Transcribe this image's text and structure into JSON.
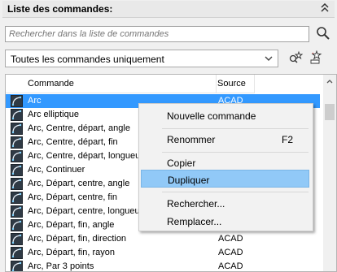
{
  "header": {
    "title": "Liste des commandes:"
  },
  "search": {
    "placeholder": "Rechercher dans la liste de commandes",
    "value": ""
  },
  "filter": {
    "selected": "Toutes les commandes uniquement"
  },
  "columns": {
    "command": "Commande",
    "source": "Source"
  },
  "rows": [
    {
      "name": "Arc",
      "source": "ACAD",
      "selected": true
    },
    {
      "name": "Arc elliptique",
      "source": ""
    },
    {
      "name": "Arc, Centre, départ, angle",
      "source": ""
    },
    {
      "name": "Arc, Centre, départ, fin",
      "source": ""
    },
    {
      "name": "Arc, Centre, départ, longueur",
      "source": ""
    },
    {
      "name": "Arc, Continuer",
      "source": ""
    },
    {
      "name": "Arc, Départ, centre, angle",
      "source": ""
    },
    {
      "name": "Arc, Départ, centre, fin",
      "source": ""
    },
    {
      "name": "Arc, Départ, centre, longueur",
      "source": ""
    },
    {
      "name": "Arc, Départ, fin, angle",
      "source": ""
    },
    {
      "name": "Arc, Départ, fin, direction",
      "source": "ACAD"
    },
    {
      "name": "Arc, Départ, fin, rayon",
      "source": "ACAD"
    },
    {
      "name": "Arc, Par 3 points",
      "source": "ACAD"
    }
  ],
  "context_menu": {
    "items": [
      {
        "label": "Nouvelle commande",
        "shortcut": ""
      },
      {
        "label": "Renommer",
        "shortcut": "F2"
      },
      {
        "label": "Copier",
        "shortcut": ""
      },
      {
        "label": "Dupliquer",
        "shortcut": "",
        "highlighted": true
      },
      {
        "label": "Rechercher...",
        "shortcut": ""
      },
      {
        "label": "Remplacer...",
        "shortcut": ""
      }
    ]
  },
  "colors": {
    "selection": "#3399ff",
    "menu_highlight": "#91c9f7",
    "icon_bg": "#2f3a45"
  },
  "icons": {
    "search": "magnifier-icon",
    "collapse": "double-chevron-up-icon",
    "tool1": "find-star-icon",
    "tool2": "new-command-star-icon",
    "row": "arc-command-icon"
  }
}
